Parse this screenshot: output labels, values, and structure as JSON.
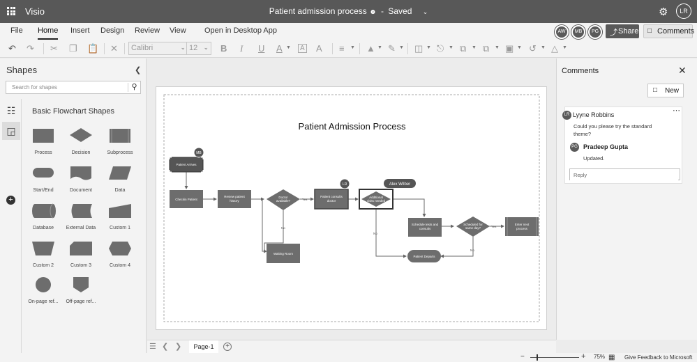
{
  "titlebar": {
    "app_name": "Visio",
    "doc_title": "Patient admission process",
    "save_status": "Saved",
    "separator": "-",
    "user_initials": "LR"
  },
  "ribbon": {
    "tabs": [
      "File",
      "Home",
      "Insert",
      "Design",
      "Review",
      "View",
      "Open in Desktop App"
    ],
    "active_tab": "Home",
    "collaborators": [
      "AW",
      "MB",
      "PG"
    ],
    "share_label": "Share",
    "comments_label": "Comments"
  },
  "toolbar": {
    "font_name": "Calibri",
    "font_size": "12",
    "bold": "B",
    "italic": "I",
    "underline": "U",
    "font_color": "A",
    "text_box": "A",
    "grow_font": "A"
  },
  "shapes_panel": {
    "title": "Shapes",
    "search_placeholder": "Search for shapes",
    "stencil_title": "Basic Flowchart Shapes",
    "shapes": [
      {
        "label": "Process",
        "icon": "process-shape-icon"
      },
      {
        "label": "Decision",
        "icon": "decision-shape-icon"
      },
      {
        "label": "Subprocess",
        "icon": "subprocess-shape-icon"
      },
      {
        "label": "Start/End",
        "icon": "start-end-shape-icon"
      },
      {
        "label": "Document",
        "icon": "document-shape-icon"
      },
      {
        "label": "Data",
        "icon": "data-shape-icon"
      },
      {
        "label": "Database",
        "icon": "database-shape-icon"
      },
      {
        "label": "External Data",
        "icon": "external-data-shape-icon"
      },
      {
        "label": "Custom 1",
        "icon": "custom-1-shape-icon"
      },
      {
        "label": "Custom 2",
        "icon": "custom-2-shape-icon"
      },
      {
        "label": "Custom 3",
        "icon": "custom-3-shape-icon"
      },
      {
        "label": "Custom 4",
        "icon": "custom-4-shape-icon"
      },
      {
        "label": "On-page ref...",
        "icon": "on-page-reference-shape-icon"
      },
      {
        "label": "Off-page ref...",
        "icon": "off-page-reference-shape-icon"
      }
    ]
  },
  "diagram": {
    "title": "Patient Admission Process",
    "nodes": {
      "patient_arrives": "Patient Arrives",
      "checkin": "Checkin Patient",
      "review_history": [
        "Review patient",
        "history"
      ],
      "doctor_available": [
        "Doctor",
        "available?"
      ],
      "patient_consults": [
        "Patient consults",
        "doctor"
      ],
      "additional_visits": [
        "Additional",
        "visits needed"
      ],
      "waiting_room": "Waiting Room",
      "schedule_tests": [
        "Schedule tests and",
        "consults"
      ],
      "scheduled_same_day": [
        "Scheduled for",
        "same day?"
      ],
      "enter_next_process": [
        "Enter next",
        "process"
      ],
      "patient_departs": "Patient Departs"
    },
    "edge_labels": {
      "yes_1": "Yes",
      "no_1": "No",
      "no_2": "No",
      "yes_2": "Yes",
      "no_3": "No"
    },
    "presence": {
      "mb": "MB",
      "lr": "LR",
      "alex": "Alex Wilber"
    }
  },
  "comments_panel": {
    "title": "Comments",
    "new_label": "New",
    "thread": {
      "author_initials": "LR",
      "author": "Lyyne Robbins",
      "text": [
        "Could you please try the standard",
        "theme?"
      ],
      "reply_initials": "PG",
      "reply_author": "Pradeep Gupta",
      "reply_text": "Updated.",
      "reply_placeholder": "Reply"
    }
  },
  "page_tabs": {
    "current": "Page-1"
  },
  "statusbar": {
    "zoom_minus": "−",
    "zoom_plus": "+",
    "zoom_fraction": 0.13,
    "zoom_level": "75%",
    "feedback": "Give Feedback to Microsoft"
  },
  "colors": {
    "titlebar": "#585858",
    "shape_fill": "#6d6d6d",
    "shape_fill_dark": "#555555",
    "connector": "#6a6a6a",
    "chrome": "#f3f3f3"
  }
}
